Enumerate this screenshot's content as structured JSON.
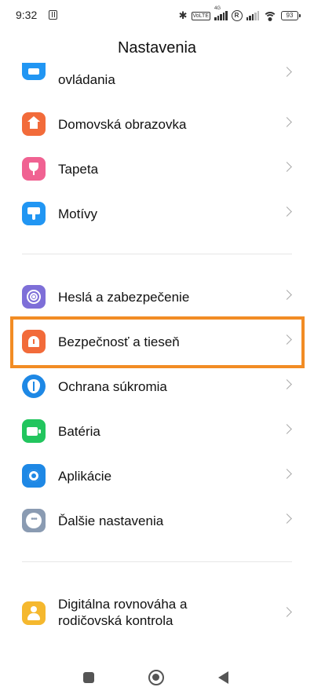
{
  "status_bar": {
    "time": "9:32",
    "network_label": "4G",
    "roaming_label": "R",
    "battery_level": "93"
  },
  "header": {
    "title": "Nastavenia"
  },
  "settings": {
    "items": [
      {
        "label": "ovládania",
        "icon": "gamepad-icon",
        "color": "#2196f3"
      },
      {
        "label": "Domovská obrazovka",
        "icon": "home-icon",
        "color": "#f26b3a"
      },
      {
        "label": "Tapeta",
        "icon": "tulip-icon",
        "color": "#f06292"
      },
      {
        "label": "Motívy",
        "icon": "paint-brush-icon",
        "color": "#2196f3"
      },
      {
        "label": "Heslá a zabezpečenie",
        "icon": "fingerprint-icon",
        "color": "#7e6fd8"
      },
      {
        "label": "Bezpečnosť a tieseň",
        "icon": "emergency-bell-icon",
        "color": "#f26b3a"
      },
      {
        "label": "Ochrana súkromia",
        "icon": "privacy-shield-icon",
        "color": "#1e88e5"
      },
      {
        "label": "Batéria",
        "icon": "battery-icon",
        "color": "#22c55e"
      },
      {
        "label": "Aplikácie",
        "icon": "gear-icon",
        "color": "#1e88e5"
      },
      {
        "label": "Ďalšie nastavenia",
        "icon": "more-dots-icon",
        "color": "#8a9bb2"
      },
      {
        "label_line1": "Digitálna rovnováha a",
        "label_line2": "rodičovská kontrola",
        "icon": "person-icon",
        "color": "#f5b82e"
      }
    ]
  },
  "highlight_color": "#f28c24"
}
